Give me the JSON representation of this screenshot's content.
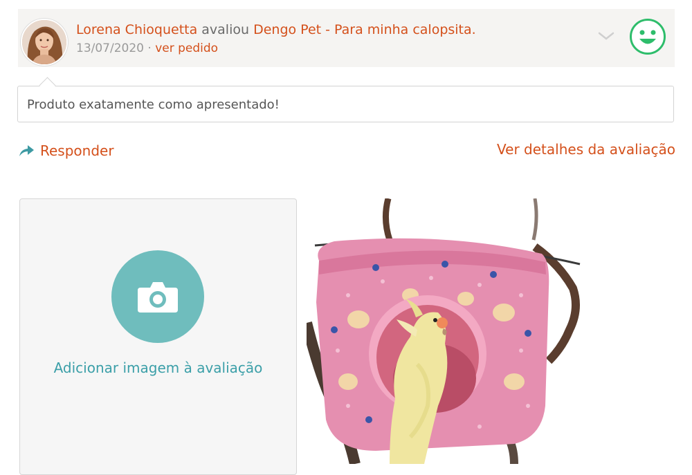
{
  "review": {
    "reviewer_name": "Lorena Chioquetta",
    "action": "avaliou",
    "product_name": "Dengo Pet - Para minha calopsita.",
    "date": "13/07/2020",
    "separator": "·",
    "order_link": "ver pedido",
    "comment": "Produto exatamente como apresentado!",
    "sentiment_icon": "happy-face-icon",
    "sentiment_color": "#2ebd6b"
  },
  "actions": {
    "reply_label": "Responder",
    "details_label": "Ver detalhes da avaliação"
  },
  "upload": {
    "label": "Adicionar imagem à avaliação",
    "icon": "camera-icon"
  },
  "colors": {
    "accent": "#d4501b",
    "teal": "#6fbdbd",
    "teal_text": "#3b9fa8",
    "header_bg": "#f5f4f2"
  }
}
